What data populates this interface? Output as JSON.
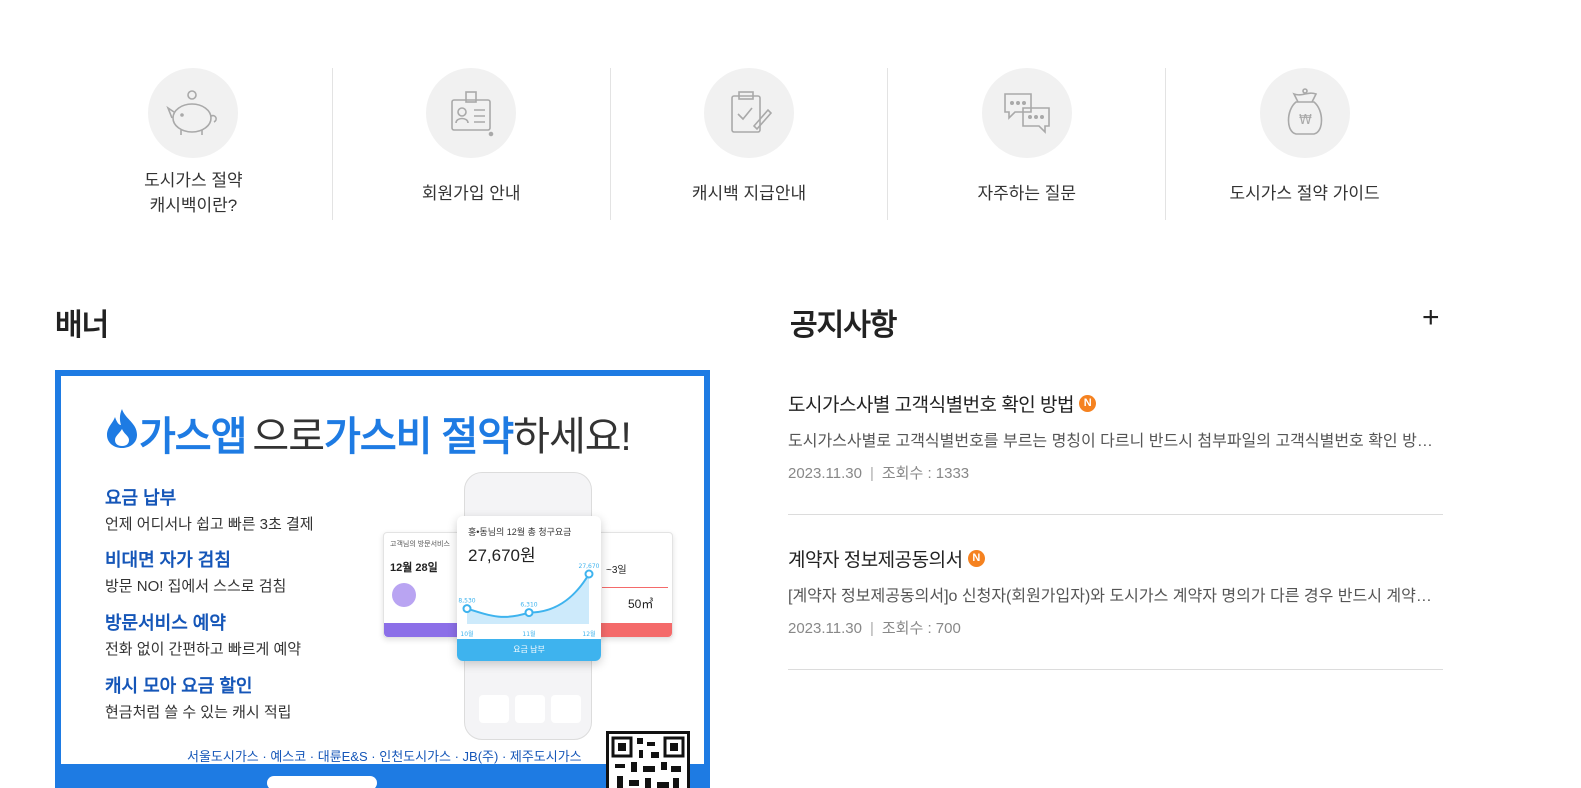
{
  "quick_menu": [
    {
      "label": "도시가스 절약\n캐시백이란?",
      "icon": "piggy-bank-icon"
    },
    {
      "label": "회원가입 안내",
      "icon": "id-card-icon"
    },
    {
      "label": "캐시백 지급안내",
      "icon": "checklist-icon"
    },
    {
      "label": "자주하는 질문",
      "icon": "chat-bubbles-icon"
    },
    {
      "label": "도시가스 절약 가이드",
      "icon": "money-bag-icon"
    }
  ],
  "banner_section": {
    "title": "배너",
    "headline": {
      "part1": "가스앱",
      "part2": "으로 ",
      "part3": "가스비 절약",
      "part4": "하세요!"
    },
    "features": [
      {
        "title": "요금 납부",
        "desc": "언제 어디서나 쉽고 빠른 3초 결제"
      },
      {
        "title": "비대면 자가 검침",
        "desc": "방문 NO! 집에서 스스로 검침"
      },
      {
        "title": "방문서비스 예약",
        "desc": "전화 없이 간편하고 빠르게 예약"
      },
      {
        "title": "캐시 모아 요금 할인",
        "desc": "현금처럼 쓸 수 있는 캐시 적립"
      }
    ],
    "companies": "서울도시가스 · 예스코 · 대륜E&S · 인천도시가스 · JB(주) · 제주도시가스",
    "phone": {
      "card_title": "홍•동님의 12월 총 청구요금",
      "amount": "27,670원",
      "pay_button": "요금 납부",
      "left_card_title": "고객님의 방문서비스",
      "left_card_date": "12월 28일",
      "right_card_value": "50㎥",
      "right_card_range": "~3일",
      "chart_months": [
        "10월",
        "11월",
        "12월"
      ],
      "chart_labels": [
        "8,530",
        "6,310",
        "27,670"
      ],
      "chart_values": [
        8530,
        6310,
        27670
      ]
    }
  },
  "notice_section": {
    "title": "공지사항",
    "more_label": "+",
    "items": [
      {
        "title": "도시가스사별 고객식별번호 확인 방법",
        "badge": "N",
        "desc": "도시가스사별로 고객식별번호를 부르는 명칭이 다르니 반드시 첨부파일의 고객식별번호 확인 방법을 참고하시기 바랍니다.",
        "date": "2023.11.30",
        "views": "조회수 : 1333"
      },
      {
        "title": "계약자 정보제공동의서",
        "badge": "N",
        "desc": "[계약자 정보제공동의서]o 신청자(회원가입자)와 도시가스 계약자 명의가 다른 경우 반드시 계약자 정보제공동의서를 제출하여 주시기 바랍니다.",
        "date": "2023.11.30",
        "views": "조회수 : 700"
      }
    ]
  },
  "colors": {
    "accent": "#1e7be3",
    "badge": "#f58220",
    "icon_bg": "#f1f1f1"
  }
}
